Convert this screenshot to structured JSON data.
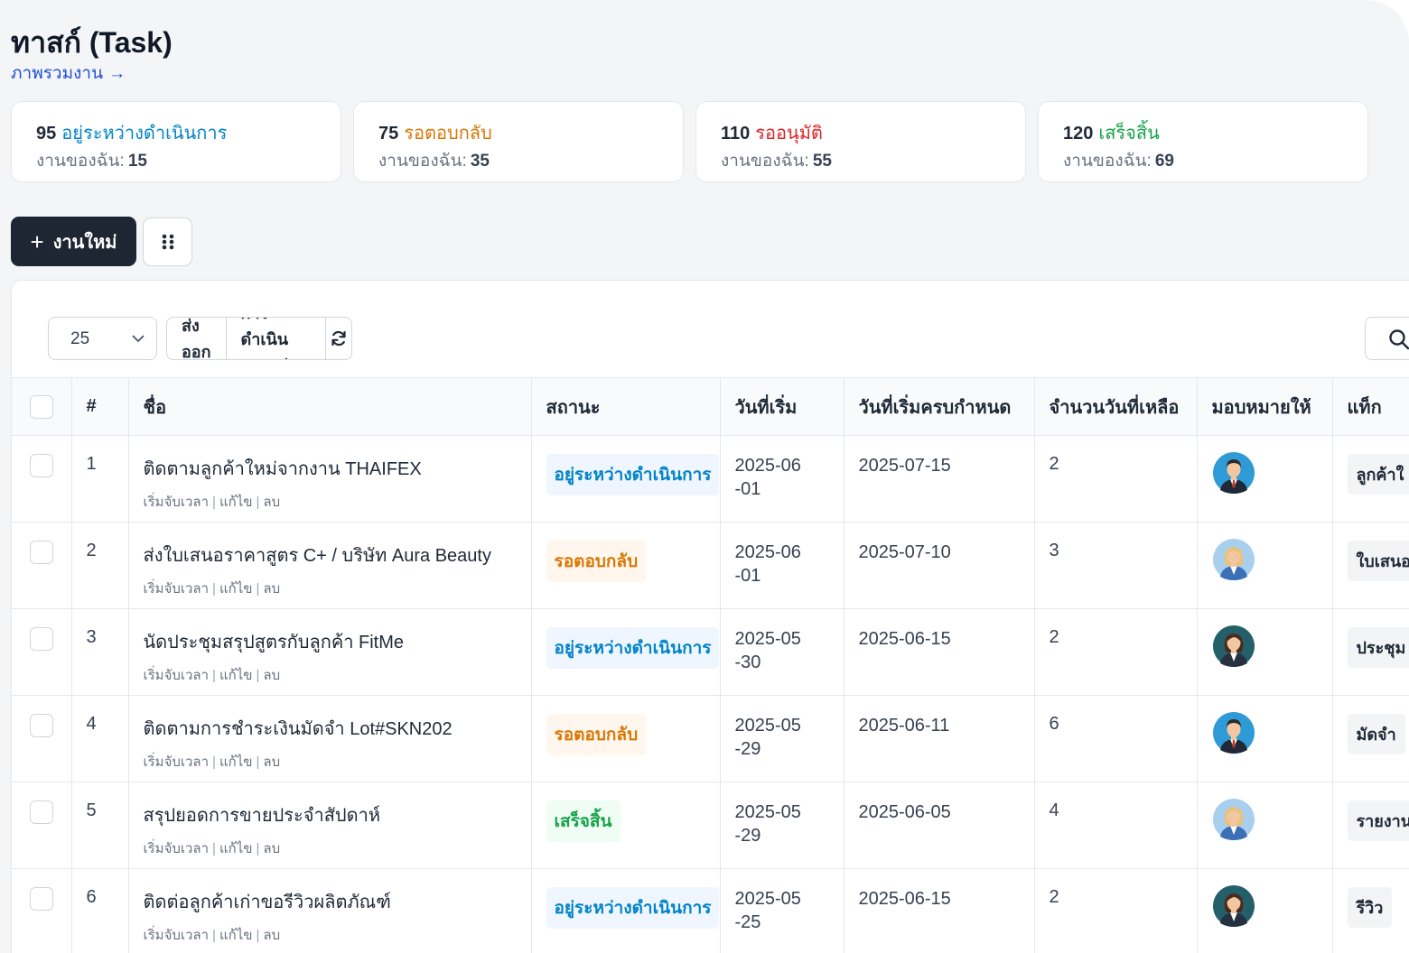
{
  "header": {
    "title": "ทาสก์ (Task)",
    "overview_link": "ภาพรวมงาน",
    "overview_arrow": "→"
  },
  "stats": [
    {
      "count": "95",
      "label": "อยู่ระหว่างดำเนินการ",
      "color": "#0284c7",
      "mine_label": "งานของฉัน:",
      "mine_value": "15"
    },
    {
      "count": "75",
      "label": "รอตอบกลับ",
      "color": "#d97706",
      "mine_label": "งานของฉัน:",
      "mine_value": "35"
    },
    {
      "count": "110",
      "label": "รออนุมัติ",
      "color": "#dc2626",
      "mine_label": "งานของฉัน:",
      "mine_value": "55"
    },
    {
      "count": "120",
      "label": "เสร็จสิ้น",
      "color": "#16a34a",
      "mine_label": "งานของฉัน:",
      "mine_value": "69"
    }
  ],
  "actions": {
    "new_task": "งานใหม่",
    "new_task_icon": "plus-icon",
    "grid_icon": "grid-dots-icon"
  },
  "toolbar": {
    "page_size": "25",
    "export": "ส่งออก",
    "bulk_action": "การดำเนินการกลุ่ม",
    "refresh_icon": "refresh-icon",
    "search_icon": "search-icon"
  },
  "table": {
    "columns": [
      "#",
      "ชื่อ",
      "สถานะ",
      "วันที่เริ่ม",
      "วันที่เริ่มครบกำหนด",
      "จำนวนวันที่เหลือ",
      "มอบหมายให้",
      "แท็ก"
    ],
    "row_actions": [
      "เริ่มจับเวลา",
      "แก้ไข",
      "ลบ"
    ],
    "rows": [
      {
        "id": "1",
        "name": "ติดตามลูกค้าใหม่จากงาน THAIFEX",
        "status": "อยู่ระหว่างดำเนินการ",
        "status_type": "progress",
        "start": "2025-06\n-01",
        "due": "2025-07-15",
        "days_left": "2",
        "avatar": "man-blue",
        "tag": "ลูกค้าใ"
      },
      {
        "id": "2",
        "name": "ส่งใบเสนอราคาสูตร C+ / บริษัท Aura Beauty",
        "status": "รอตอบกลับ",
        "status_type": "waiting",
        "start": "2025-06\n-01",
        "due": "2025-07-10",
        "days_left": "3",
        "avatar": "woman-blonde",
        "tag": "ใบเสนอ"
      },
      {
        "id": "3",
        "name": "นัดประชุมสรุปสูตรกับลูกค้า FitMe",
        "status": "อยู่ระหว่างดำเนินการ",
        "status_type": "progress",
        "start": "2025-05\n-30",
        "due": "2025-06-15",
        "days_left": "2",
        "avatar": "woman-dark",
        "tag": "ประชุม"
      },
      {
        "id": "4",
        "name": "ติดตามการชำระเงินมัดจำ Lot#SKN202",
        "status": "รอตอบกลับ",
        "status_type": "waiting",
        "start": "2025-05\n-29",
        "due": "2025-06-11",
        "days_left": "6",
        "avatar": "man-blue",
        "tag": "มัดจำ"
      },
      {
        "id": "5",
        "name": "สรุปยอดการขายประจำสัปดาห์",
        "status": "เสร็จสิ้น",
        "status_type": "done",
        "start": "2025-05\n-29",
        "due": "2025-06-05",
        "days_left": "4",
        "avatar": "woman-blonde",
        "tag": "รายงาน"
      },
      {
        "id": "6",
        "name": "ติดต่อลูกค้าเก่าขอรีวิวผลิตภัณฑ์",
        "status": "อยู่ระหว่างดำเนินการ",
        "status_type": "progress",
        "start": "2025-05\n-25",
        "due": "2025-06-15",
        "days_left": "2",
        "avatar": "woman-dark",
        "tag": "รีวิว"
      }
    ]
  }
}
